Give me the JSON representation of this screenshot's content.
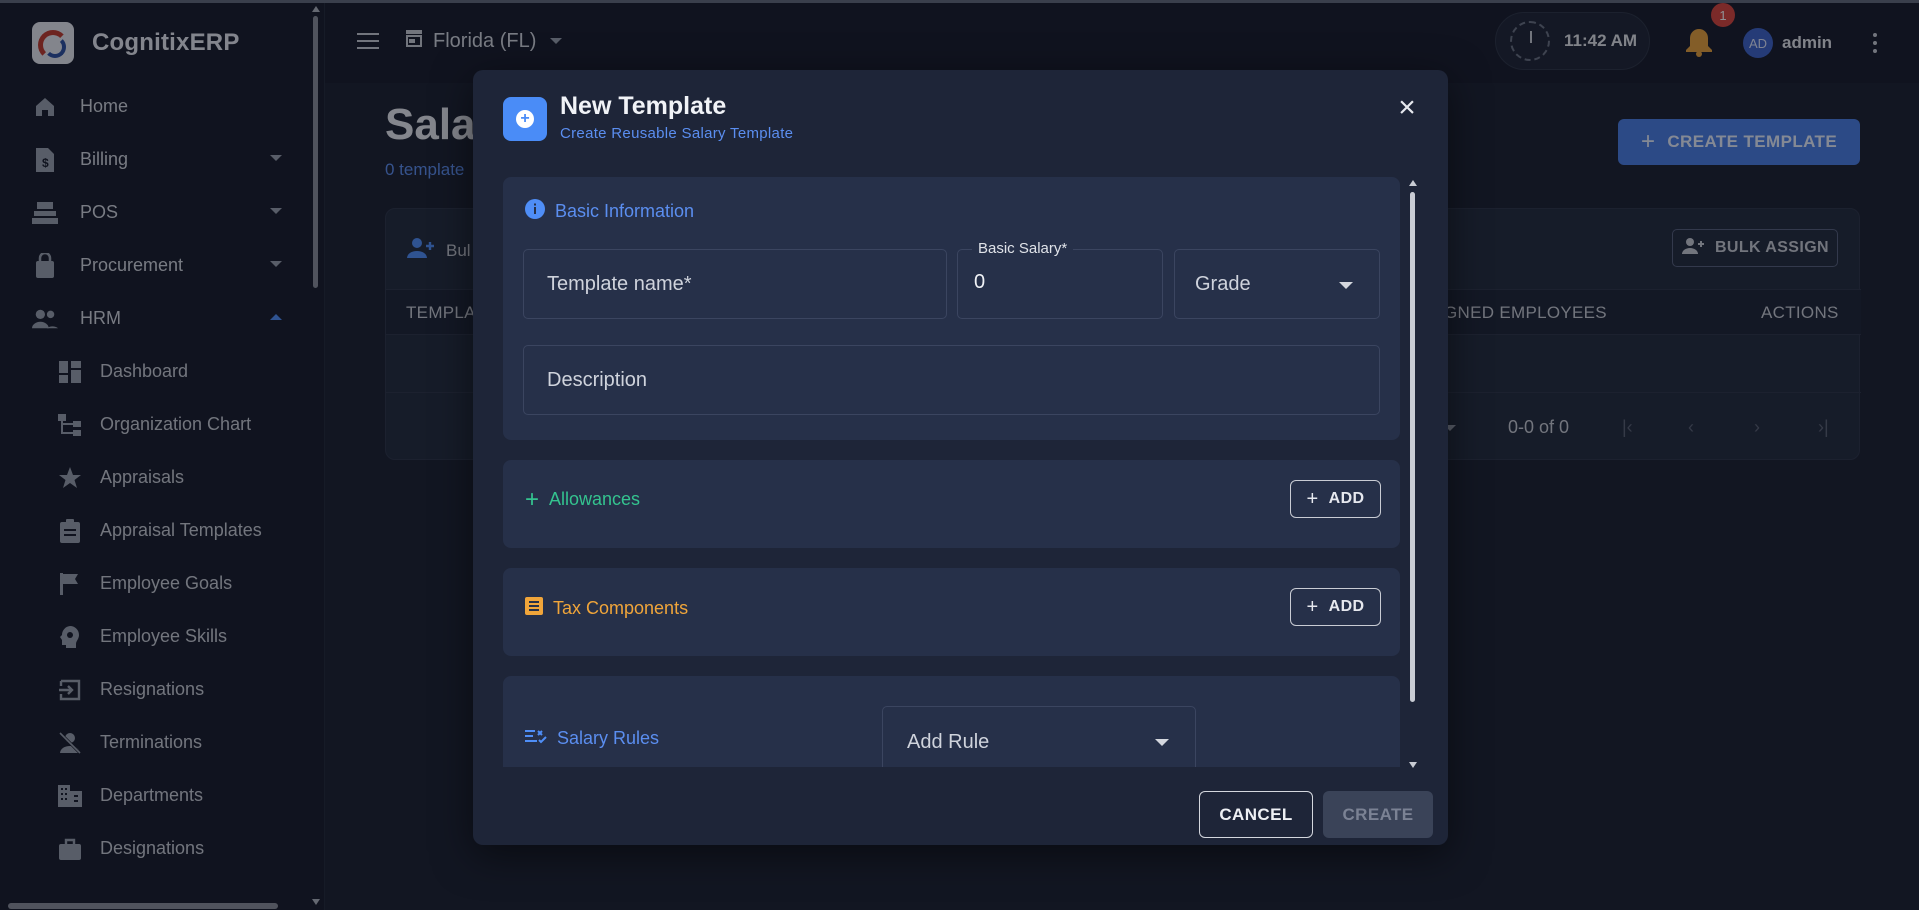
{
  "app": {
    "name": "CognitixERP"
  },
  "sidebar": {
    "items": [
      {
        "label": "Home",
        "icon": "home-icon",
        "expandable": false
      },
      {
        "label": "Billing",
        "icon": "billing-icon",
        "expandable": true
      },
      {
        "label": "POS",
        "icon": "pos-icon",
        "expandable": true
      },
      {
        "label": "Procurement",
        "icon": "procurement-icon",
        "expandable": true
      },
      {
        "label": "HRM",
        "icon": "hrm-icon",
        "expandable": true,
        "expanded": true
      }
    ],
    "hrm_sub_items": [
      {
        "label": "Dashboard",
        "icon": "dashboard-icon"
      },
      {
        "label": "Organization Chart",
        "icon": "org-chart-icon"
      },
      {
        "label": "Appraisals",
        "icon": "star-icon"
      },
      {
        "label": "Appraisal Templates",
        "icon": "clipboard-icon"
      },
      {
        "label": "Employee Goals",
        "icon": "flag-icon"
      },
      {
        "label": "Employee Skills",
        "icon": "skills-icon"
      },
      {
        "label": "Resignations",
        "icon": "exit-icon"
      },
      {
        "label": "Terminations",
        "icon": "person-off-icon"
      },
      {
        "label": "Departments",
        "icon": "building-icon"
      },
      {
        "label": "Designations",
        "icon": "briefcase-icon"
      }
    ]
  },
  "topbar": {
    "store": "Florida (FL)",
    "time": "11:42 AM",
    "notification_count": "1",
    "avatar_initials": "AD",
    "username": "admin"
  },
  "page": {
    "title": "Sala",
    "subtitle": "0 template",
    "create_button": "CREATE TEMPLATE",
    "bulk_left": "Bul",
    "bulk_assign": "BULK ASSIGN",
    "columns": {
      "first": "TEMPLA",
      "assigned": "GNED EMPLOYEES",
      "actions": "ACTIONS"
    },
    "pagination": "0-0 of 0"
  },
  "modal": {
    "title": "New Template",
    "subtitle": "Create Reusable Salary Template",
    "basic_info": {
      "title": "Basic Information",
      "template_name_placeholder": "Template name*",
      "basic_salary_label": "Basic Salary*",
      "basic_salary_value": "0",
      "grade_placeholder": "Grade",
      "description_placeholder": "Description"
    },
    "allowances": {
      "title": "Allowances",
      "add_label": "ADD"
    },
    "tax_components": {
      "title": "Tax Components",
      "add_label": "ADD"
    },
    "salary_rules": {
      "title": "Salary Rules",
      "add_rule_placeholder": "Add Rule"
    },
    "cancel_label": "CANCEL",
    "create_label": "CREATE"
  },
  "colors": {
    "accent_blue": "#4a8cf7",
    "allowances_green": "#34c38f",
    "tax_orange": "#f0a53a",
    "notification_red": "#d9443b"
  }
}
